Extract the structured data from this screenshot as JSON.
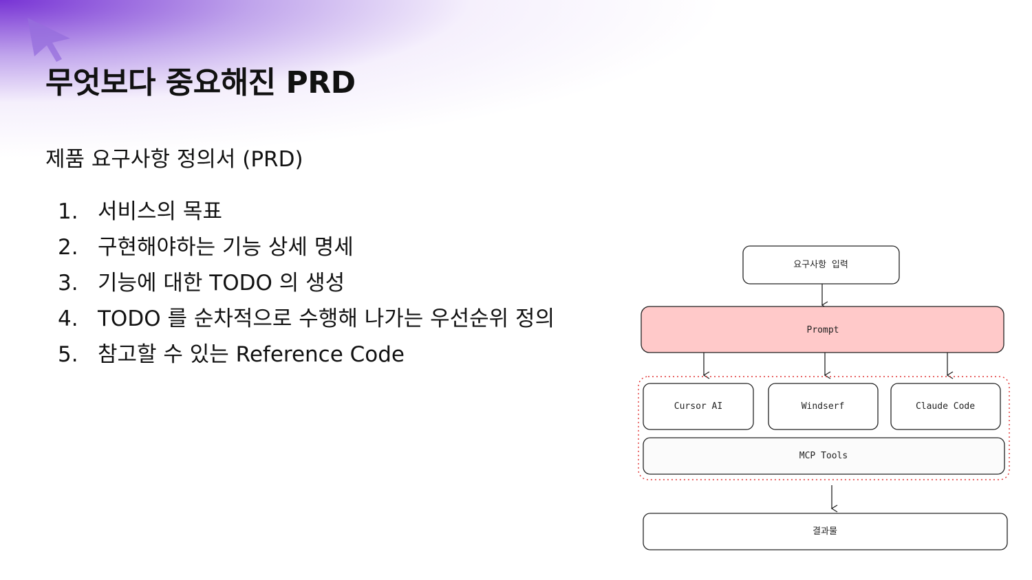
{
  "slide": {
    "title": "무엇보다 중요해진 PRD",
    "subtitle": "제품 요구사항 정의서 (PRD)",
    "items": [
      {
        "number": "1.",
        "text": "서비스의 목표"
      },
      {
        "number": "2.",
        "text": "구현해야하는 기능 상세 명세"
      },
      {
        "number": "3.",
        "text": "기능에 대한 TODO 의 생성"
      },
      {
        "number": "4.",
        "text": "TODO 를 순차적으로 수행해 나가는 우선순위 정의"
      },
      {
        "number": "5.",
        "text": "참고할 수 있는 Reference Code"
      }
    ]
  },
  "diagram": {
    "input_label": "요구사항 입력",
    "prompt_label": "Prompt",
    "tools": [
      "Cursor AI",
      "Windserf",
      "Claude Code"
    ],
    "mcp_label": "MCP Tools",
    "output_label": "결과물",
    "prompt_fill": "#ffc9c9",
    "group_border": "#e03131"
  },
  "icons": {
    "cursor": "cursor-arrow-icon"
  }
}
